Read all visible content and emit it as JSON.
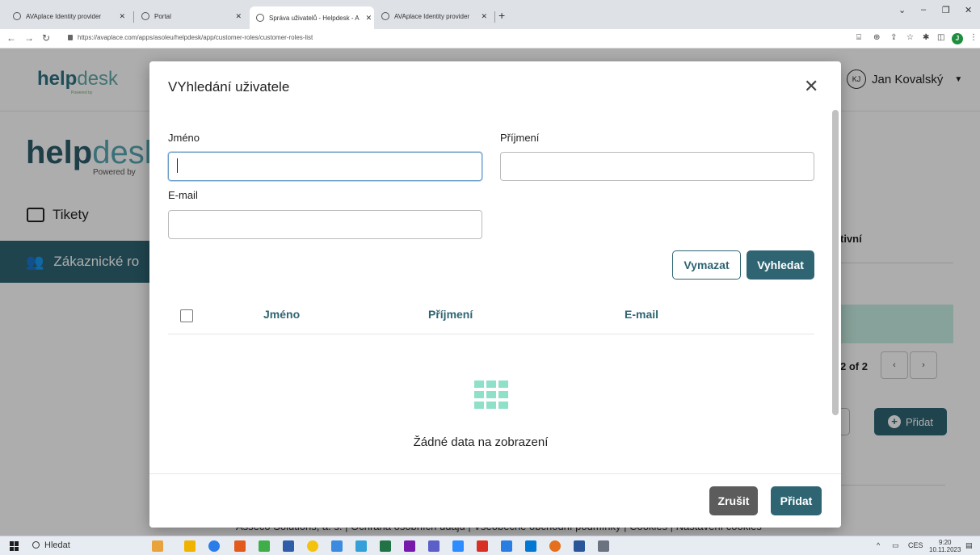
{
  "browser": {
    "tabs": [
      {
        "label": "AVAplace Identity provider"
      },
      {
        "label": "Portal"
      },
      {
        "label": "Správa uživatelů - Helpdesk - A"
      },
      {
        "label": "AVAplace Identity provider"
      }
    ],
    "url": "https://avaplace.com/apps/asoleu/helpdesk/app/customer-roles/customer-roles-list",
    "profile_initial": "J"
  },
  "app": {
    "logo_main": "help",
    "logo_light": "desk",
    "logo_small_sub": "Powered by",
    "logo_big_sub": "Powered by",
    "user": {
      "initials": "KJ",
      "name": "Jan Kovalský"
    },
    "nav": {
      "tikety": "Tikety",
      "zakaznicke": "Zákaznické ro"
    },
    "bg": {
      "tivni": "tivní",
      "pagination": "2 of 2",
      "add_label": "Přidat"
    },
    "footer": "Asseco Solutions, a. s.  |  Ochrana osobních údajů  |  Všeobecné obchodní podmínky  |  Cookies  |  Nastavení cookies"
  },
  "modal": {
    "title": "VYhledání uživatele",
    "fields": {
      "jmeno_label": "Jméno",
      "prijmeni_label": "Příjmení",
      "email_label": "E-mail"
    },
    "buttons": {
      "clear": "Vymazat",
      "search": "Vyhledat",
      "cancel": "Zrušit",
      "add": "Přidat"
    },
    "table": {
      "columns": [
        "Jméno",
        "Příjmení",
        "E-mail"
      ]
    },
    "empty_text": "Žádné data na zobrazení"
  },
  "taskbar": {
    "search": "Hledat",
    "lang": "CES",
    "time": "9:20",
    "date": "10.11.2023"
  },
  "colors": {
    "primary": "#2f6573",
    "accent_light": "#8fe0c8"
  }
}
